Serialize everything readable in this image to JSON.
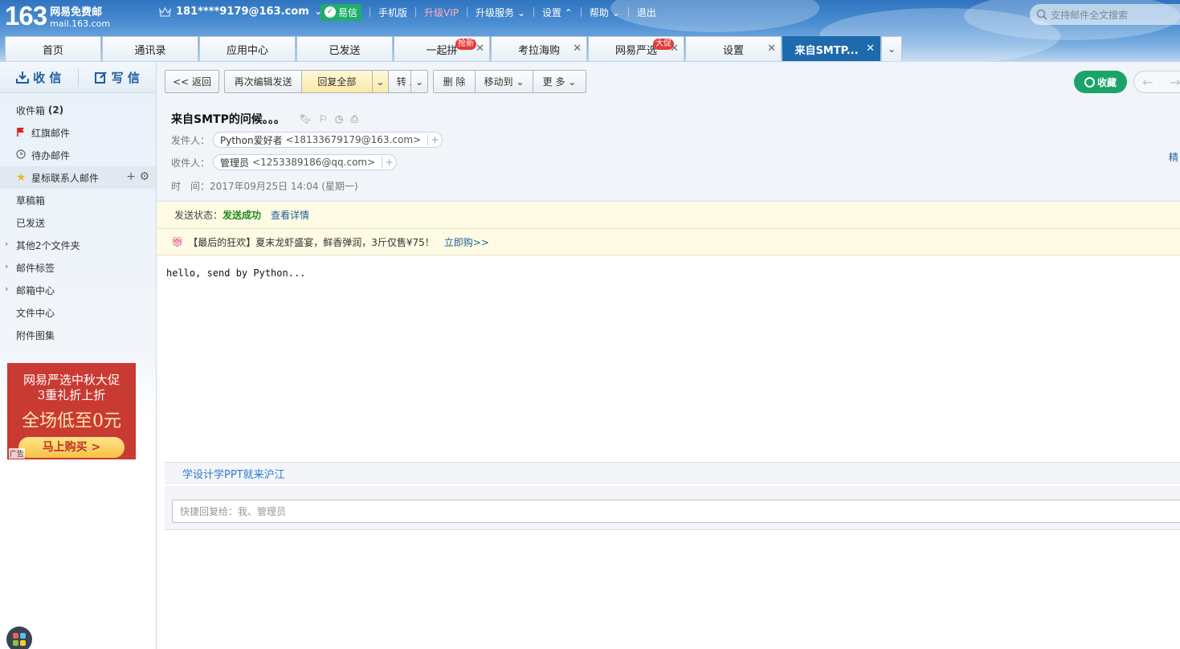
{
  "logo": {
    "num": "163",
    "name": "网易免费邮",
    "domain": "mail.163.com"
  },
  "user": {
    "email": "181****9179@163.com"
  },
  "topnav": {
    "yixin": "易信",
    "mobile": "手机版",
    "vip": "升级VIP",
    "upgrade": "升级服务",
    "settings": "设置",
    "help": "帮助",
    "logout": "退出"
  },
  "search": {
    "placeholder": "支持邮件全文搜索"
  },
  "tabs": [
    {
      "label": "首页"
    },
    {
      "label": "通讯录"
    },
    {
      "label": "应用中心"
    },
    {
      "label": "已发送"
    },
    {
      "label": "一起拼",
      "badge": "抢新"
    },
    {
      "label": "考拉海购"
    },
    {
      "label": "网易严选",
      "badge": "大促"
    },
    {
      "label": "设置"
    },
    {
      "label": "来自SMTP..."
    }
  ],
  "sidebar": {
    "receive": "收 信",
    "write": "写 信",
    "folders": [
      {
        "label": "收件箱",
        "count": "(2)"
      },
      {
        "label": "红旗邮件"
      },
      {
        "label": "待办邮件"
      },
      {
        "label": "星标联系人邮件"
      },
      {
        "label": "草稿箱"
      },
      {
        "label": "已发送"
      },
      {
        "label": "其他2个文件夹"
      },
      {
        "label": "邮件标签"
      },
      {
        "label": "邮箱中心"
      },
      {
        "label": "文件中心"
      },
      {
        "label": "附件图集"
      }
    ],
    "ad": {
      "line1": "网易严选中秋大促",
      "line2": "3重礼折上折",
      "line3": "全场低至0元",
      "button": "马上购买 >",
      "tag": "广告"
    }
  },
  "toolbar": {
    "back": "返回",
    "reedit": "再次编辑发送",
    "replyall": "回复全部",
    "forward": "转 发",
    "delete": "删 除",
    "moveto": "移动到",
    "more": "更 多",
    "fav": "收藏"
  },
  "mail": {
    "subject": "来自SMTP的问候。。。",
    "from_label": "发件人：",
    "from_name": "Python爱好者",
    "from_email": "<18133679179@163.com>",
    "to_label": "收件人：",
    "to_name": "管理员",
    "to_email": "<1253389186@qq.com>",
    "time_label": "时　间：",
    "time": "2017年09月25日 14:04 (星期一)",
    "status_label": "发送状态：",
    "status": "发送成功",
    "status_detail": "查看详情",
    "promo": "【最后的狂欢】夏末龙虾盛宴，鲜香弹润，3斤仅售¥75！",
    "promo_link": "立即购>>",
    "body": "hello, send by Python...",
    "right_cut": "精"
  },
  "footer": {
    "link": "学设计学PPT就来沪江",
    "reply_placeholder": "快捷回复给：我、管理员"
  },
  "colors": {
    "brand": "#2f74c0",
    "active_tab": "#1f6aad",
    "fav_green": "#1ba36a",
    "yixin_green": "#1fae6a",
    "ad_red": "#c93a32"
  }
}
